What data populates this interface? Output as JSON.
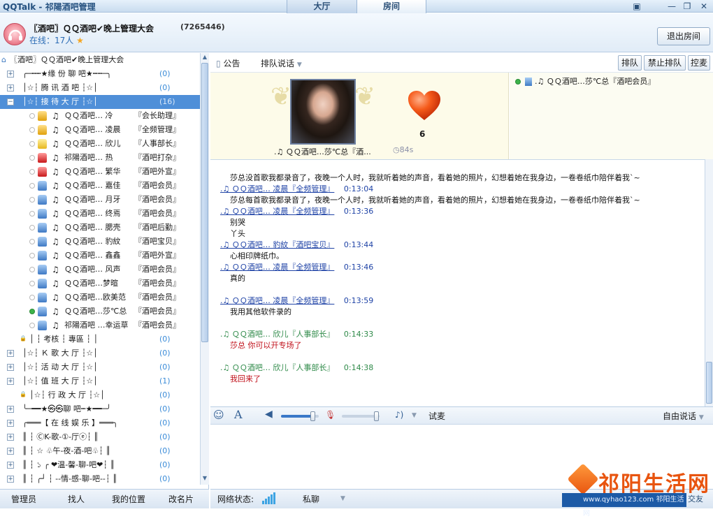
{
  "window": {
    "app_name": "QQTalk",
    "title_room": "祁陽酒吧管理",
    "tabs": [
      "大厅",
      "房间"
    ]
  },
  "header": {
    "room_title": "〖酒吧〗ＱＱ酒吧✔晚上管理大会",
    "room_id": "(7265446)",
    "online_label": "在线：17人",
    "exit_button": "退出房间"
  },
  "tree": {
    "root": "〖酒吧〗ＱＱ酒吧✔晚上管理大会",
    "channels": [
      {
        "label": "╭─┅┅★缘 份 聊 吧★┅┅─╮",
        "count": "(0)"
      },
      {
        "label": "│☆┆     腾 讯 酒 吧     ┆☆│",
        "count": "(0)"
      },
      {
        "label": "│☆┆     接 待 大 厅     ┆☆│",
        "count": "(16)"
      }
    ],
    "members": [
      {
        "nick": "ＱＱ酒吧…  冷",
        "role": "『会长助理』",
        "avatar": "gold",
        "note": "♫",
        "online": false
      },
      {
        "nick": "ＱＱ酒吧…  凌晨",
        "role": "『全频管理』",
        "avatar": "gold",
        "note": "♫",
        "online": false
      },
      {
        "nick": "ＱＱ酒吧…  欣儿",
        "role": "『人事部长』",
        "avatar": "yellow",
        "note": "♫",
        "online": false
      },
      {
        "nick": "祁陽酒吧…  热",
        "role": "『酒吧打杂』",
        "avatar": "red",
        "note": "♫",
        "online": false
      },
      {
        "nick": "ＱＱ酒吧…  繁华",
        "role": "『酒吧外宣』",
        "avatar": "red",
        "note": "♫",
        "online": false
      },
      {
        "nick": "ＱＱ酒吧…  嘉佳",
        "role": "『酒吧会员』",
        "avatar": "blue",
        "note": "♫",
        "online": false
      },
      {
        "nick": "ＱＱ酒吧…  月牙",
        "role": "『酒吧会员』",
        "avatar": "blue",
        "note": "♫",
        "online": false
      },
      {
        "nick": "ＱＱ酒吧…  终焉",
        "role": "『酒吧会员』",
        "avatar": "blue",
        "note": "♫",
        "online": false
      },
      {
        "nick": "ＱＱ酒吧…  腮壳",
        "role": "『酒吧后勤』",
        "avatar": "blue",
        "note": "♫",
        "online": false
      },
      {
        "nick": "ＱＱ酒吧…  豹紋",
        "role": "『酒吧宝贝』",
        "avatar": "blue",
        "note": "♫",
        "online": false
      },
      {
        "nick": "ＱＱ酒吧…  鑫鑫",
        "role": "『酒吧外宣』",
        "avatar": "blue",
        "note": "♫",
        "online": false
      },
      {
        "nick": "ＱＱ酒吧…  风声",
        "role": "『酒吧会员』",
        "avatar": "blue",
        "note": "♫",
        "online": false
      },
      {
        "nick": "ＱＱ酒吧…梦暄",
        "role": "『酒吧会员』",
        "avatar": "blue",
        "note": "♫",
        "online": false
      },
      {
        "nick": "ＱＱ酒吧…欧美范",
        "role": "『酒吧会员』",
        "avatar": "blue",
        "note": "♫",
        "online": false
      },
      {
        "nick": "ＱＱ酒吧…莎℃总",
        "role": "『酒吧会员』",
        "avatar": "blue",
        "note": "♫",
        "online": true
      },
      {
        "nick": "祁陽酒吧 …幸运草",
        "role": "『酒吧会员』",
        "avatar": "blue",
        "note": "♫",
        "online": false
      }
    ],
    "more_channels": [
      {
        "label": "│  ┆     考核    ┆    專區    ┆  │",
        "count": "(0)",
        "locked": true
      },
      {
        "label": "│☆┆     Ｋ 歌 大 厅     ┆☆│",
        "count": "(0)"
      },
      {
        "label": "│☆┆     活 动 大 厅     ┆☆│",
        "count": "(0)"
      },
      {
        "label": "│☆┆     值 班 大 厅     ┆☆│",
        "count": "(1)"
      },
      {
        "label": "│☆┆     行 政 大 厅     ┆☆│",
        "count": "(0)",
        "locked": true
      },
      {
        "label": "╰─━━★㉿㉿聊 吧┅★━━─╯",
        "count": "(0)"
      },
      {
        "label": "╭═══【 在 线 娱 乐 】═══╮",
        "count": "(0)"
      },
      {
        "label": "║ ┆        ⒸK-歌-①-厅ⓔ┆ ║",
        "count": "(0)"
      },
      {
        "label": "║ ┆    ☆  ♧午-夜-酒-吧♧┆ ║",
        "count": "(0)"
      },
      {
        "label": "║ ┆ ১ ╭  ❤温-馨-聊-吧❤┆ ║",
        "count": "(0)"
      },
      {
        "label": "║ ┆ ╭┘ ┆ --情-感-聊-吧--┆ ║",
        "count": "(0)"
      }
    ]
  },
  "bottom_left": [
    "管理员",
    "找人",
    "我的位置",
    "改名片"
  ],
  "toolbar": {
    "notice": "公告",
    "queue_mode": "排队说话",
    "buttons": [
      "排队",
      "禁止排队",
      "控麦"
    ]
  },
  "stage": {
    "speaker_name": ".♫ ＱＱ酒吧…莎℃总『酒...",
    "heart_count": "6",
    "timer": "84s"
  },
  "queue": {
    "items": [
      ".♫ ＱＱ酒吧…莎℃总『酒吧会员』"
    ]
  },
  "chat": {
    "messages": [
      {
        "type": "text",
        "text": "莎总没首歌我都录音了，夜晚一个人时，我就听着她的声音，看着她的照片，幻想着她在我身边，一卷卷纸巾陪伴着我`~"
      },
      {
        "type": "head",
        "style": "blue",
        "name": ".♫ ＱＱ酒吧…  凌晨『全频管理』",
        "time": "0:13:04"
      },
      {
        "type": "text",
        "text": "莎总每首歌我都录音了，夜晚一个人时，我就听着她的声音，看着她的照片，幻想着她在我身边，一卷卷纸巾陪伴着我`~"
      },
      {
        "type": "head",
        "style": "blue",
        "name": ".♫ ＱＱ酒吧…  凌晨『全频管理』",
        "time": "0:13:36"
      },
      {
        "type": "text",
        "text": "别哭"
      },
      {
        "type": "text",
        "text": "丫头"
      },
      {
        "type": "head",
        "style": "blue",
        "name": ".♫ ＱＱ酒吧…  豹紋『酒吧宝贝』",
        "time": "0:13:44"
      },
      {
        "type": "text",
        "text": "心相印牌纸巾。"
      },
      {
        "type": "head",
        "style": "blue",
        "name": ".♫ ＱＱ酒吧…  凌晨『全频管理』",
        "time": "0:13:46"
      },
      {
        "type": "text",
        "text": "真的"
      },
      {
        "type": "gap"
      },
      {
        "type": "head",
        "style": "blue",
        "name": ".♫ ＱＱ酒吧…  凌晨『全频管理』",
        "time": "0:13:59"
      },
      {
        "type": "text",
        "text": "我用其他软件录的"
      },
      {
        "type": "gap"
      },
      {
        "type": "head",
        "style": "green",
        "name": ".♫ ＱＱ酒吧…  欣儿『人事部长』",
        "time": "0:14:33"
      },
      {
        "type": "text_red",
        "text": "莎总 你可以开专场了"
      },
      {
        "type": "gap"
      },
      {
        "type": "head",
        "style": "green",
        "name": ".♫ ＱＱ酒吧…  欣儿『人事部长』",
        "time": "0:14:38"
      },
      {
        "type": "text_red",
        "text": "我回来了"
      }
    ]
  },
  "input_bar": {
    "test_label": "试麦",
    "speak_mode": "自由说话",
    "speaker_volume": 0.85,
    "mic_volume": 0.0
  },
  "status": {
    "network_label": "网络状态:",
    "private_chat": "私聊"
  },
  "watermark": {
    "brand": "祁阳生活网",
    "url": "www.qyhao123.com 祁阳生活网",
    "corner": "交友"
  },
  "colors": {
    "selected_row": "#4f8fd8",
    "chat_name_blue": "#1f43a6",
    "chat_name_green": "#2f8a49",
    "chat_text_red": "#c0101a",
    "count_blue": "#3a8bd8"
  }
}
